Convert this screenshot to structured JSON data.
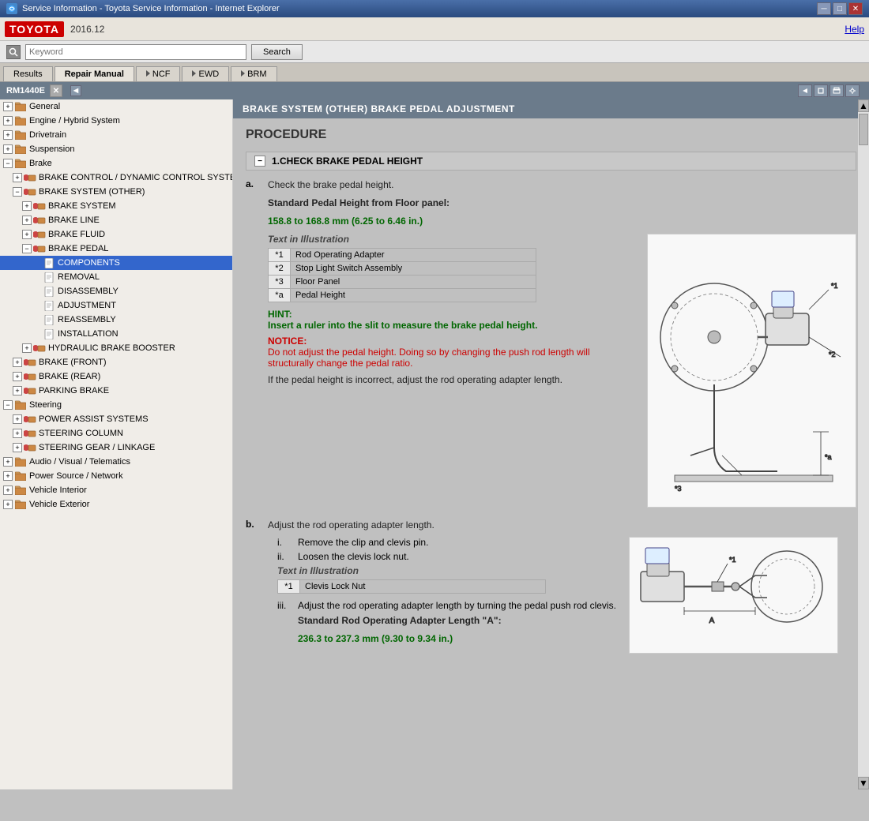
{
  "window": {
    "title": "Service Information - Toyota Service Information - Internet Explorer",
    "minimize": "─",
    "restore": "□",
    "close": "✕"
  },
  "header": {
    "logo": "TOYOTA",
    "version": "2016.12",
    "help": "Help"
  },
  "search": {
    "placeholder": "Keyword",
    "button_label": "Search"
  },
  "tabs": {
    "results": "Results",
    "repair_manual": "Repair Manual",
    "ncf": "NCF",
    "ewd": "EWD",
    "brm": "BRM"
  },
  "rm_bar": {
    "title": "RM1440E",
    "collapse_arrow": "◄"
  },
  "sidebar": {
    "items": [
      {
        "id": "general",
        "label": "General",
        "level": 1,
        "expanded": false,
        "icon": "folder"
      },
      {
        "id": "engine",
        "label": "Engine / Hybrid System",
        "level": 1,
        "expanded": false,
        "icon": "folder"
      },
      {
        "id": "drivetrain",
        "label": "Drivetrain",
        "level": 1,
        "expanded": false,
        "icon": "folder"
      },
      {
        "id": "suspension",
        "label": "Suspension",
        "level": 1,
        "expanded": false,
        "icon": "folder"
      },
      {
        "id": "brake",
        "label": "Brake",
        "level": 1,
        "expanded": true,
        "icon": "folder"
      },
      {
        "id": "brake-control",
        "label": "BRAKE CONTROL / DYNAMIC CONTROL SYSTEMS",
        "level": 2,
        "expanded": false,
        "icon": "folder"
      },
      {
        "id": "brake-system",
        "label": "BRAKE SYSTEM (OTHER)",
        "level": 2,
        "expanded": true,
        "icon": "folder"
      },
      {
        "id": "brake-system-sub",
        "label": "BRAKE SYSTEM",
        "level": 3,
        "expanded": false,
        "icon": "folder"
      },
      {
        "id": "brake-line",
        "label": "BRAKE LINE",
        "level": 3,
        "expanded": false,
        "icon": "folder"
      },
      {
        "id": "brake-fluid",
        "label": "BRAKE FLUID",
        "level": 3,
        "expanded": false,
        "icon": "folder"
      },
      {
        "id": "brake-pedal",
        "label": "BRAKE PEDAL",
        "level": 3,
        "expanded": true,
        "icon": "folder"
      },
      {
        "id": "components",
        "label": "COMPONENTS",
        "level": 4,
        "expanded": false,
        "icon": "page",
        "selected": true
      },
      {
        "id": "removal",
        "label": "REMOVAL",
        "level": 4,
        "expanded": false,
        "icon": "page"
      },
      {
        "id": "disassembly",
        "label": "DISASSEMBLY",
        "level": 4,
        "expanded": false,
        "icon": "page"
      },
      {
        "id": "adjustment",
        "label": "ADJUSTMENT",
        "level": 4,
        "expanded": false,
        "icon": "page"
      },
      {
        "id": "reassembly",
        "label": "REASSEMBLY",
        "level": 4,
        "expanded": false,
        "icon": "page"
      },
      {
        "id": "installation",
        "label": "INSTALLATION",
        "level": 4,
        "expanded": false,
        "icon": "page"
      },
      {
        "id": "hydraulic",
        "label": "HYDRAULIC BRAKE BOOSTER",
        "level": 3,
        "expanded": false,
        "icon": "folder"
      },
      {
        "id": "brake-front",
        "label": "BRAKE (FRONT)",
        "level": 2,
        "expanded": false,
        "icon": "folder"
      },
      {
        "id": "brake-rear",
        "label": "BRAKE (REAR)",
        "level": 2,
        "expanded": false,
        "icon": "folder"
      },
      {
        "id": "parking-brake",
        "label": "PARKING BRAKE",
        "level": 2,
        "expanded": false,
        "icon": "folder"
      },
      {
        "id": "steering",
        "label": "Steering",
        "level": 1,
        "expanded": true,
        "icon": "folder"
      },
      {
        "id": "power-assist",
        "label": "POWER ASSIST SYSTEMS",
        "level": 2,
        "expanded": false,
        "icon": "folder"
      },
      {
        "id": "steering-column",
        "label": "STEERING COLUMN",
        "level": 2,
        "expanded": false,
        "icon": "folder"
      },
      {
        "id": "steering-gear",
        "label": "STEERING GEAR / LINKAGE",
        "level": 2,
        "expanded": false,
        "icon": "folder"
      },
      {
        "id": "audio",
        "label": "Audio / Visual / Telematics",
        "level": 1,
        "expanded": false,
        "icon": "folder"
      },
      {
        "id": "power",
        "label": "Power Source / Network",
        "level": 1,
        "expanded": false,
        "icon": "folder"
      },
      {
        "id": "interior",
        "label": "Vehicle Interior",
        "level": 1,
        "expanded": false,
        "icon": "folder"
      },
      {
        "id": "exterior",
        "label": "Vehicle Exterior",
        "level": 1,
        "expanded": false,
        "icon": "folder"
      }
    ]
  },
  "content": {
    "header": "BRAKE SYSTEM (OTHER)  BRAKE PEDAL  ADJUSTMENT",
    "procedure_title": "PROCEDURE",
    "section_title": "1.CHECK BRAKE PEDAL HEIGHT",
    "step_a": {
      "label": "a.",
      "text": "Check the brake pedal height.",
      "standard": "Standard Pedal Height from Floor panel:",
      "measurement": "158.8 to 168.8 mm (6.25 to 6.46 in.)",
      "text_in_illustration": "Text in Illustration",
      "table": [
        {
          "ref": "*1",
          "desc": "Rod Operating Adapter"
        },
        {
          "ref": "*2",
          "desc": "Stop Light Switch Assembly"
        },
        {
          "ref": "*3",
          "desc": "Floor Panel"
        },
        {
          "ref": "*a",
          "desc": "Pedal Height"
        }
      ],
      "hint_label": "HINT:",
      "hint_text": "Insert a ruler into the slit to measure the brake pedal height.",
      "notice_label": "NOTICE:",
      "notice_text": "Do not adjust the pedal height. Doing so by changing the push rod length will structurally change the pedal ratio.",
      "step_end_text": "If the pedal height is incorrect, adjust the rod operating adapter length."
    },
    "step_b": {
      "label": "b.",
      "text": "Adjust the rod operating adapter length.",
      "sub_i": "Remove the clip and clevis pin.",
      "sub_ii": "Loosen the clevis lock nut.",
      "text_in_illustration": "Text in Illustration",
      "table_b": [
        {
          "ref": "*1",
          "desc": "Clevis Lock Nut"
        }
      ],
      "sub_iii_label": "iii.",
      "sub_iii_text": "Adjust the rod operating adapter length by turning the pedal push rod clevis.",
      "standard_b": "Standard Rod Operating Adapter Length \"A\":",
      "measurement_b": "236.3 to 237.3 mm (9.30 to 9.34 in.)"
    }
  }
}
